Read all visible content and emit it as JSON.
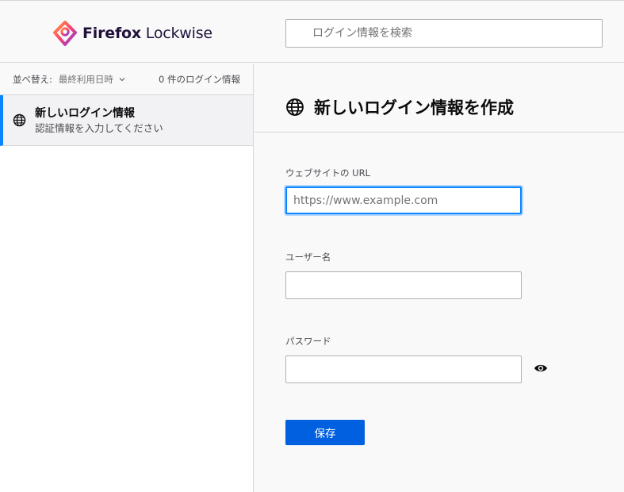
{
  "header": {
    "brand_part1": "Firefox",
    "brand_part2": " Lockwise",
    "search_placeholder": "ログイン情報を検索"
  },
  "sidebar": {
    "sort_label": "並べ替え:",
    "sort_value": "最終利用日時",
    "login_count": "0 件のログイン情報",
    "items": [
      {
        "title": "新しいログイン情報",
        "subtitle": "認証情報を入力してください",
        "icon": "globe-icon"
      }
    ]
  },
  "main": {
    "title": "新しいログイン情報を作成",
    "url_label": "ウェブサイトの URL",
    "url_placeholder": "https://www.example.com",
    "url_value": "",
    "username_label": "ユーザー名",
    "username_value": "",
    "password_label": "パスワード",
    "password_value": "",
    "save_label": "保存"
  },
  "colors": {
    "accent": "#0a84ff",
    "primary_button": "#0060df",
    "background": "#f9f9fa",
    "border": "#d7d7db"
  }
}
